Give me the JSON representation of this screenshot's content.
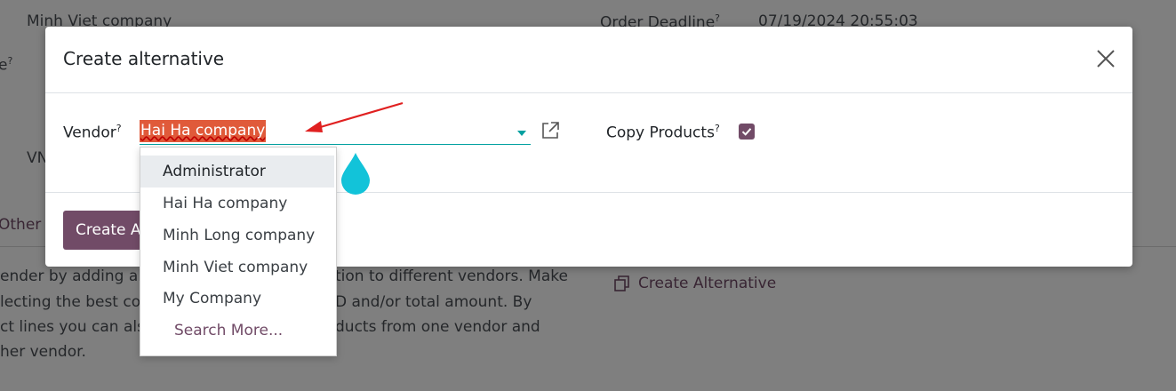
{
  "background": {
    "company_value": "Minh Viet company",
    "deadline_label": "Order Deadline",
    "deadline_help": "?",
    "deadline_value": "07/19/2024 20:55:03",
    "cut_label_suffix": "e",
    "cut_help": "?",
    "cut_vn": "VN",
    "other_info_tab": "Other In",
    "help_lines": [
      "ender by adding alte",
      "lecting the best con",
      "ct lines you can also",
      "her vendor."
    ],
    "help_right_lines": [
      "tion to different vendors. Make",
      "D and/or total amount. By",
      "ducts from one vendor and"
    ],
    "create_alternative_link": "Create Alternative"
  },
  "modal": {
    "title": "Create alternative",
    "vendor_label": "Vendor",
    "vendor_help": "?",
    "vendor_value": "Hai Ha company",
    "copy_products_label": "Copy Products",
    "copy_products_help": "?",
    "copy_products_checked": true,
    "footer_button": "Create A"
  },
  "dropdown": {
    "items": [
      "Administrator",
      "Hai Ha company",
      "Minh Long company",
      "Minh Viet company",
      "My Company"
    ],
    "search_more": "Search More..."
  },
  "colors": {
    "accent": "#714b67",
    "input_focus": "#01a0a0",
    "highlight": "#e05a3a",
    "annotation_arrow": "#e02020",
    "cursor_drop": "#12c3d9"
  }
}
